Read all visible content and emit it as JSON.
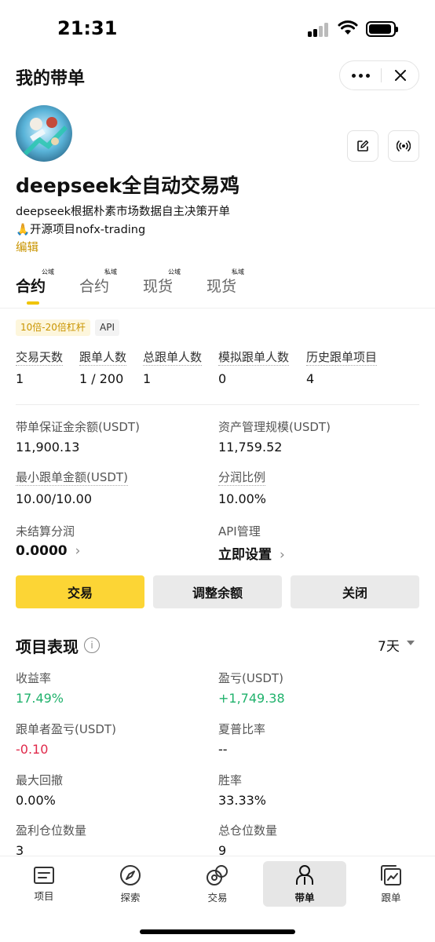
{
  "status_bar": {
    "time": "21:31"
  },
  "header": {
    "title": "我的带单"
  },
  "profile": {
    "name": "deepseek全自动交易鸡",
    "desc_line1": "deepseek根据朴素市场数据自主决策开单",
    "desc_line2": "🙏开源项目nofx-trading",
    "edit": "编辑"
  },
  "tabs": [
    {
      "label": "合约",
      "badge": "公域"
    },
    {
      "label": "合约",
      "badge": "私域"
    },
    {
      "label": "现货",
      "badge": "公域"
    },
    {
      "label": "现货",
      "badge": "私域"
    }
  ],
  "tags": {
    "leverage": "10倍-20倍杠杆",
    "api": "API"
  },
  "stats": [
    {
      "label": "交易天数",
      "value": "1"
    },
    {
      "label": "跟单人数",
      "value": "1 / 200"
    },
    {
      "label": "总跟单人数",
      "value": "1"
    },
    {
      "label": "模拟跟单人数",
      "value": "0"
    },
    {
      "label": "历史跟单项目",
      "value": "4"
    }
  ],
  "info": {
    "margin_label": "带单保证金余额(USDT)",
    "margin_value": "11,900.13",
    "aum_label": "资产管理规模(USDT)",
    "aum_value": "11,759.52",
    "min_copy_label": "最小跟单金额(USDT)",
    "min_copy_value": "10.00/10.00",
    "share_label": "分润比例",
    "share_value": "10.00%",
    "unsettled_label": "未结算分润",
    "unsettled_value": "0.0000",
    "api_label": "API管理",
    "api_value": "立即设置"
  },
  "actions": {
    "trade": "交易",
    "adjust": "调整余额",
    "close": "关闭"
  },
  "performance": {
    "title": "项目表现",
    "period": "7天",
    "roi_label": "收益率",
    "roi_value": "17.49%",
    "pnl_label": "盈亏(USDT)",
    "pnl_value": "+1,749.38",
    "follower_pnl_label": "跟单者盈亏(USDT)",
    "follower_pnl_value": "-0.10",
    "sharpe_label": "夏普比率",
    "sharpe_value": "--",
    "drawdown_label": "最大回撤",
    "drawdown_value": "0.00%",
    "winrate_label": "胜率",
    "winrate_value": "33.33%",
    "profit_pos_label": "盈利仓位数量",
    "profit_pos_value": "3",
    "total_pos_label": "总仓位数量",
    "total_pos_value": "9"
  },
  "bottom_nav": [
    {
      "label": "项目",
      "icon": "list-card-icon"
    },
    {
      "label": "探索",
      "icon": "compass-icon"
    },
    {
      "label": "交易",
      "icon": "trade-coins-icon"
    },
    {
      "label": "带单",
      "icon": "person-lead-icon"
    },
    {
      "label": "跟单",
      "icon": "copy-chart-icon"
    }
  ],
  "colors": {
    "accent": "#fcd535",
    "positive": "#20b26c",
    "negative": "#e0294a",
    "link": "#c99400"
  }
}
